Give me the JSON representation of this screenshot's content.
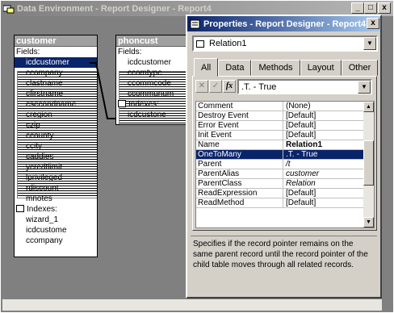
{
  "main_window": {
    "title": "Data Environment - Report Designer - Report4"
  },
  "tables": [
    {
      "name": "customer",
      "header_row": "Fields:",
      "fields": [
        "icdcustomer",
        "ccompany",
        "clastname",
        "cfirstname",
        "csecondname",
        "cregion",
        "czip",
        "ccounty",
        "ccity",
        "caddies",
        "ycredtlimit",
        "lprivileged",
        "rdiscount",
        "mnotes"
      ],
      "index_header": "Indexes:",
      "indexes": [
        "wizard_1",
        "icdcustome",
        "ccompany"
      ],
      "selected": "icdcustomer"
    },
    {
      "name": "phoncust",
      "header_row": "Fields:",
      "fields": [
        "icdcustomer",
        "ccomtypc",
        "ccommcode",
        "ccommunum"
      ],
      "index_header": "Indexes:",
      "indexes": [
        "icdcustone"
      ]
    }
  ],
  "properties": {
    "title": "Properties - Report Designer - Report4",
    "object_combo": "Relation1",
    "tabs": [
      "All",
      "Data",
      "Methods",
      "Layout",
      "Other"
    ],
    "active_tab": "All",
    "value_combo": ".T. - True",
    "rows": [
      {
        "name": "Comment",
        "value": "(None)"
      },
      {
        "name": "Destroy Event",
        "value": "[Default]"
      },
      {
        "name": "Error Event",
        "value": "[Default]"
      },
      {
        "name": "Init Event",
        "value": "[Default]"
      },
      {
        "name": "Name",
        "value": "Relation1"
      },
      {
        "name": "OneToMany",
        "value": ".T. - True"
      },
      {
        "name": "Parent",
        "value": "/t"
      },
      {
        "name": "ParentAlias",
        "value": "customer"
      },
      {
        "name": "ParentClass",
        "value": "Relation"
      },
      {
        "name": "ReadExpression",
        "value": "[Default]"
      },
      {
        "name": "ReadMethod",
        "value": "[Default]"
      }
    ],
    "description": "Specifies if the record pointer remains on the same parent record until the record pointer of the child table moves through all related records."
  },
  "window_buttons": {
    "minimize": "_",
    "maximize": "□",
    "close": "x"
  }
}
